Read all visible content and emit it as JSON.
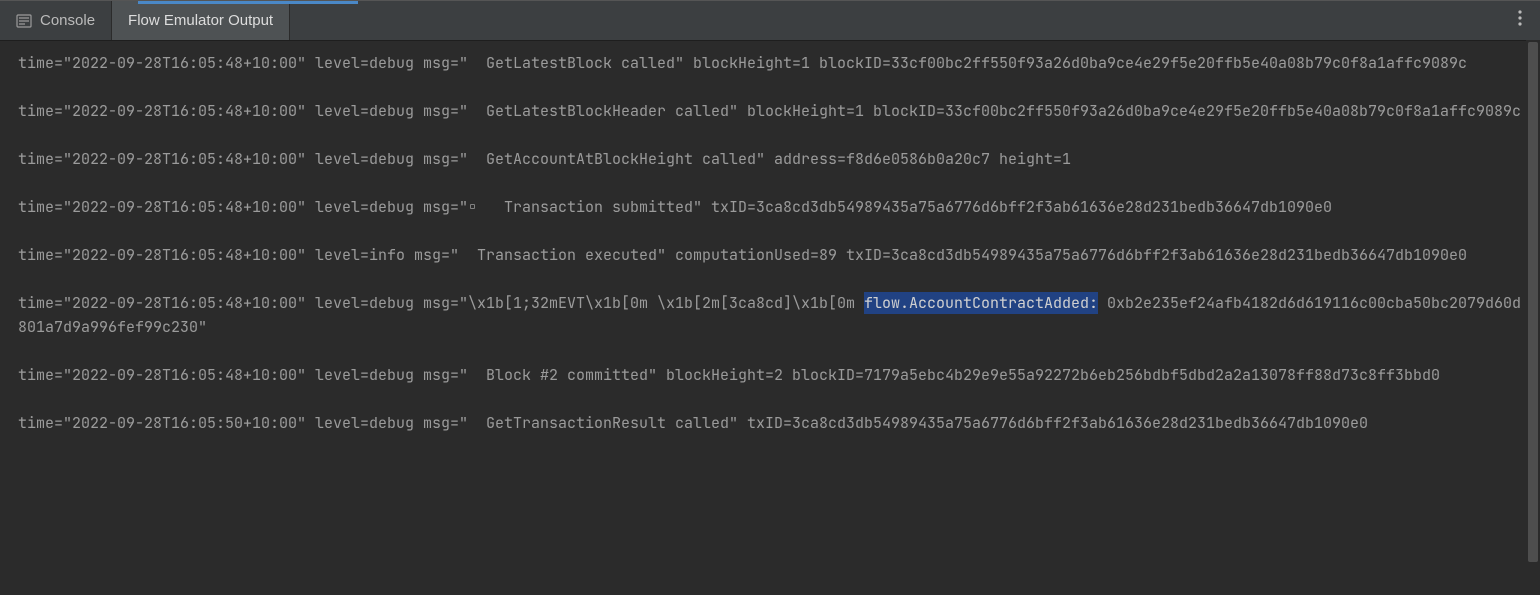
{
  "tabs": {
    "console": "Console",
    "flow": "Flow Emulator Output"
  },
  "log": {
    "l1": "time=\"2022-09-28T16:05:48+10:00\" level=debug msg=\"  GetLatestBlock called\" blockHeight=1 blockID=33cf00bc2ff550f93a26d0ba9ce4e29f5e20ffb5e40a08b79c0f8a1affc9089c",
    "l2": "",
    "l3": "time=\"2022-09-28T16:05:48+10:00\" level=debug msg=\"  GetLatestBlockHeader called\" blockHeight=1 blockID=33cf00bc2ff550f93a26d0ba9ce4e29f5e20ffb5e40a08b79c0f8a1affc9089c",
    "l4": "",
    "l5": "time=\"2022-09-28T16:05:48+10:00\" level=debug msg=\"  GetAccountAtBlockHeight called\" address=f8d6e0586b0a20c7 height=1",
    "l6": "",
    "l7": "time=\"2022-09-28T16:05:48+10:00\" level=debug msg=\"▫   Transaction submitted\" txID=3ca8cd3db54989435a75a6776d6bff2f3ab61636e28d231bedb36647db1090e0",
    "l8": "",
    "l9": "time=\"2022-09-28T16:05:48+10:00\" level=info msg=\"  Transaction executed\" computationUsed=89 txID=3ca8cd3db54989435a75a6776d6bff2f3ab61636e28d231bedb36647db1090e0",
    "l10": "",
    "l11a": "time=\"2022-09-28T16:05:48+10:00\" level=debug msg=\"\\x1b[1;32mEVT\\x1b[0m \\x1b[2m[3ca8cd]\\x1b[0m ",
    "l11sel": "flow.AccountContractAdded:",
    "l11b": " 0xb2e235ef24afb4182d6d619116c00cba50bc2079d60d801a7d9a996fef99c230\"",
    "l12": "",
    "l13": "time=\"2022-09-28T16:05:48+10:00\" level=debug msg=\"  Block #2 committed\" blockHeight=2 blockID=7179a5ebc4b29e9e55a92272b6eb256bdbf5dbd2a2a13078ff88d73c8ff3bbd0",
    "l14": "",
    "l15": "time=\"2022-09-28T16:05:50+10:00\" level=debug msg=\"  GetTransactionResult called\" txID=3ca8cd3db54989435a75a6776d6bff2f3ab61636e28d231bedb36647db1090e0"
  }
}
